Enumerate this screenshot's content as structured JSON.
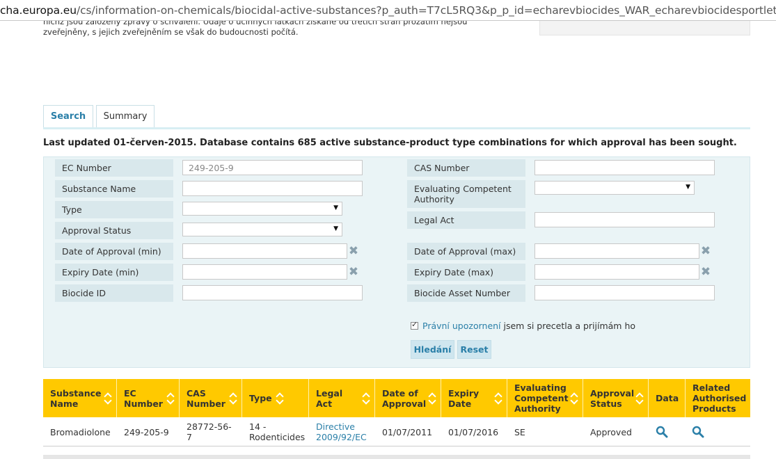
{
  "browser": {
    "url_host": "cha.europa.eu",
    "url_path": "/cs/information-on-chemicals/biocidal-active-substances?p_auth=T7cL5RQ3&p_p_id=echarevbiocides_WAR_echarevbiocidesportlet&p_p_lifecycl"
  },
  "intro": {
    "line1": "nichž jsou založeny zprávy o schválení. Údaje o účinných látkách získané od třetích stran prozatím nejsou",
    "line2": "zveřejněny, s jejich zveřejněním se však do budoucnosti počítá."
  },
  "tabs": [
    {
      "label": "Search"
    },
    {
      "label": "Summary"
    }
  ],
  "last_updated": "Last updated 01-červen-2015. Database contains 685 active substance-product type combinations for which approval has been sought.",
  "form": {
    "ec_number": {
      "label": "EC Number",
      "placeholder": "249-205-9"
    },
    "cas_number": {
      "label": "CAS Number",
      "value": ""
    },
    "substance_name": {
      "label": "Substance Name",
      "value": ""
    },
    "evaluating_authority": {
      "label_line1": "Evaluating Competent",
      "label_line2": "Authority",
      "value": ""
    },
    "type": {
      "label": "Type",
      "value": ""
    },
    "approval_status": {
      "label": "Approval Status",
      "value": ""
    },
    "legal_act": {
      "label": "Legal Act",
      "value": ""
    },
    "date_approval_min": {
      "label": "Date of Approval (min)",
      "value": ""
    },
    "date_approval_max": {
      "label": "Date of Approval (max)",
      "value": ""
    },
    "expiry_min": {
      "label": "Expiry Date (min)",
      "value": ""
    },
    "expiry_max": {
      "label": "Expiry Date (max)",
      "value": ""
    },
    "biocide_id": {
      "label": "Biocide ID",
      "value": ""
    },
    "biocide_asset": {
      "label": "Biocide Asset Number",
      "value": ""
    },
    "legal_link": "Právní upozornení",
    "legal_text": " jsem si precetla a prijímám ho",
    "legal_checked": true,
    "search_button": "Hledání",
    "reset_button": "Reset"
  },
  "table": {
    "header_color": "#ffc900",
    "columns": [
      {
        "l1": "Substance",
        "l2": "Name",
        "sortable": true
      },
      {
        "l1": "EC",
        "l2": "Number",
        "sortable": true
      },
      {
        "l1": "CAS",
        "l2": "Number",
        "sortable": true
      },
      {
        "l1": "Type",
        "l2": "",
        "sortable": true
      },
      {
        "l1": "Legal",
        "l2": "Act",
        "sortable": true
      },
      {
        "l1": "Date of",
        "l2": "Approval",
        "sortable": true
      },
      {
        "l1": "Expiry",
        "l2": "Date",
        "sortable": true
      },
      {
        "l1": "Evaluating",
        "l2": "Competent",
        "l3": "Authority",
        "sortable": true
      },
      {
        "l1": "Approval",
        "l2": "Status",
        "sortable": true
      },
      {
        "l1": "Data",
        "l2": "",
        "sortable": false
      },
      {
        "l1": "Related",
        "l2": "Authorised",
        "l3": "Products",
        "sortable": false
      }
    ],
    "rows": [
      {
        "substance_name": "Bromadiolone",
        "ec_number": "249-205-9",
        "cas_l1": "28772-56-",
        "cas_l2": "7",
        "type_l1": "14 -",
        "type_l2": "Rodenticides",
        "legal_l1": "Directive",
        "legal_l2": "2009/92/EC",
        "date_of_approval": "01/07/2011",
        "expiry_date": "01/07/2016",
        "authority": "SE",
        "status": "Approved",
        "data_icon": "search-icon",
        "products_icon": "search-icon"
      }
    ]
  }
}
